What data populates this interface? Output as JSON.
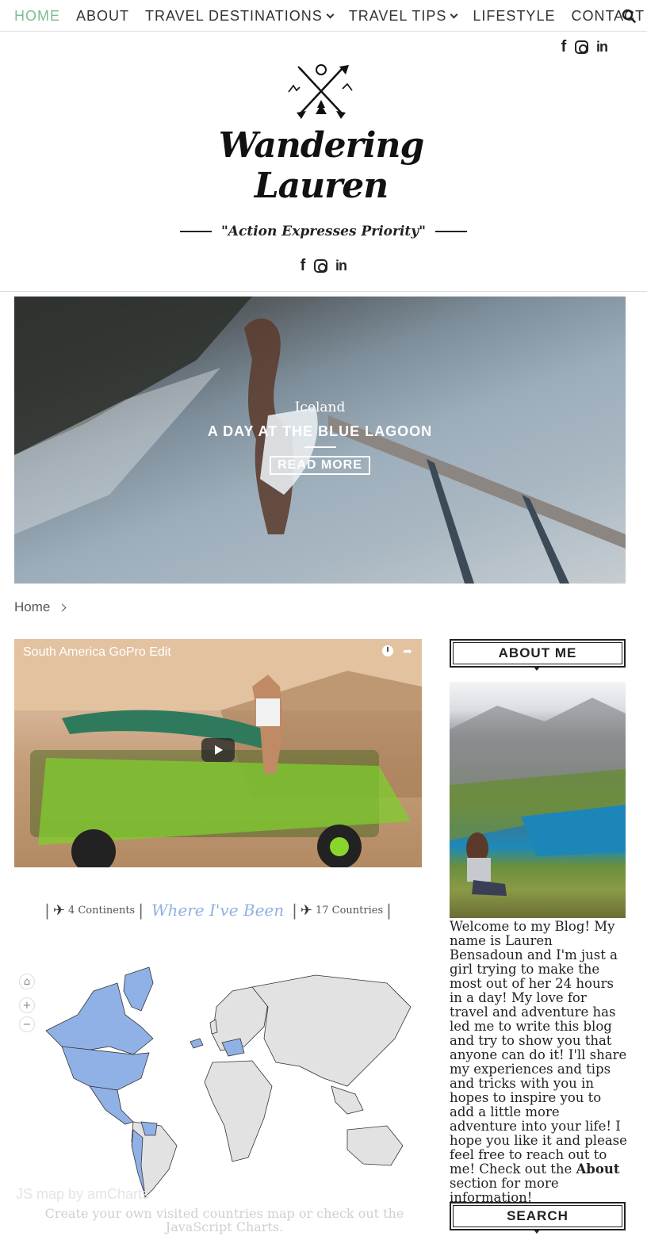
{
  "nav": {
    "items": [
      {
        "label": "HOME",
        "active": true,
        "dropdown": false
      },
      {
        "label": "ABOUT",
        "active": false,
        "dropdown": false
      },
      {
        "label": "TRAVEL DESTINATIONS",
        "active": false,
        "dropdown": true
      },
      {
        "label": "TRAVEL TIPS",
        "active": false,
        "dropdown": true
      },
      {
        "label": "LIFESTYLE",
        "active": false,
        "dropdown": false
      },
      {
        "label": "CONTACT",
        "active": false,
        "dropdown": false
      }
    ],
    "search_icon": "search-icon",
    "active_color": "#7dbd8e"
  },
  "social": [
    "facebook-icon",
    "instagram-icon",
    "linkedin-icon"
  ],
  "brand": {
    "name": "Wandering Lauren",
    "tagline": "\"Action Expresses Priority\""
  },
  "hero": {
    "category": "Iceland",
    "title": "A DAY AT THE BLUE LAGOON",
    "button": "READ MORE"
  },
  "breadcrumb": {
    "home": "Home"
  },
  "video": {
    "title": "South America GoPro Edit"
  },
  "map_section": {
    "continents": "4 Continents",
    "title": "Where I've Been",
    "countries": "17 Countries",
    "credit": "JS map by amCharts",
    "note": "Create your own visited countries map or check out the JavaScript Charts.",
    "visited_color": "#8fb1e6",
    "unvisited_color": "#e2e2e2"
  },
  "sidebar": {
    "about_title": "ABOUT ME",
    "about_text": "Welcome to my Blog! My name is Lauren Bensadoun and I'm just a girl trying to make the most out of her 24 hours in a day! My love for travel and adventure has led me to write this blog and try to show you that anyone can do it! I'll share my experiences and tips and tricks with you in hopes to inspire you to add a little more adventure into your life! I hope you like it and please feel free to reach out to me! Check out the ",
    "about_bold": "About",
    "about_tail": " section for more information!",
    "search_title": "SEARCH"
  }
}
